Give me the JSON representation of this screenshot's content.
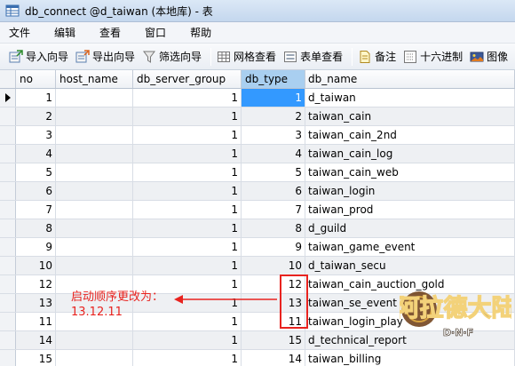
{
  "window": {
    "title": "db_connect @d_taiwan (本地库) - 表"
  },
  "menu": [
    "文件",
    "编辑",
    "查看",
    "窗口",
    "帮助"
  ],
  "toolbar": {
    "import_wizard": "导入向导",
    "export_wizard": "导出向导",
    "filter_wizard": "筛选向导",
    "grid_view": "网格查看",
    "form_view": "表单查看",
    "memo": "备注",
    "hex": "十六进制",
    "image": "图像"
  },
  "table": {
    "columns": [
      "no",
      "host_name",
      "db_server_group",
      "db_type",
      "db_name"
    ],
    "rows": [
      {
        "no": "1",
        "host_name": "",
        "db_server_group": "1",
        "db_type": "1",
        "db_name": "d_taiwan"
      },
      {
        "no": "2",
        "host_name": "",
        "db_server_group": "1",
        "db_type": "2",
        "db_name": "taiwan_cain"
      },
      {
        "no": "3",
        "host_name": "",
        "db_server_group": "1",
        "db_type": "3",
        "db_name": "taiwan_cain_2nd"
      },
      {
        "no": "4",
        "host_name": "",
        "db_server_group": "1",
        "db_type": "4",
        "db_name": "taiwan_cain_log"
      },
      {
        "no": "5",
        "host_name": "",
        "db_server_group": "1",
        "db_type": "5",
        "db_name": "taiwan_cain_web"
      },
      {
        "no": "6",
        "host_name": "",
        "db_server_group": "1",
        "db_type": "6",
        "db_name": "taiwan_login"
      },
      {
        "no": "7",
        "host_name": "",
        "db_server_group": "1",
        "db_type": "7",
        "db_name": "taiwan_prod"
      },
      {
        "no": "8",
        "host_name": "",
        "db_server_group": "1",
        "db_type": "8",
        "db_name": "d_guild"
      },
      {
        "no": "9",
        "host_name": "",
        "db_server_group": "1",
        "db_type": "9",
        "db_name": "taiwan_game_event"
      },
      {
        "no": "10",
        "host_name": "",
        "db_server_group": "1",
        "db_type": "10",
        "db_name": "d_taiwan_secu"
      },
      {
        "no": "12",
        "host_name": "",
        "db_server_group": "1",
        "db_type": "12",
        "db_name": "taiwan_cain_auction_gold"
      },
      {
        "no": "13",
        "host_name": "",
        "db_server_group": "1",
        "db_type": "13",
        "db_name": "taiwan_se_event"
      },
      {
        "no": "11",
        "host_name": "",
        "db_server_group": "1",
        "db_type": "11",
        "db_name": "taiwan_login_play"
      },
      {
        "no": "14",
        "host_name": "",
        "db_server_group": "1",
        "db_type": "15",
        "db_name": "d_technical_report"
      },
      {
        "no": "15",
        "host_name": "",
        "db_server_group": "1",
        "db_type": "14",
        "db_name": "taiwan_billing"
      }
    ]
  },
  "annotation": {
    "line1": "启动顺序更改为：",
    "line2": "13.12.11"
  },
  "watermark": {
    "text": "阿拉德大陆",
    "sub": "D·N·F"
  },
  "colors": {
    "annotation": "#e8231f",
    "selection": "#3399ff",
    "active_column_header": "#a9cff0"
  }
}
